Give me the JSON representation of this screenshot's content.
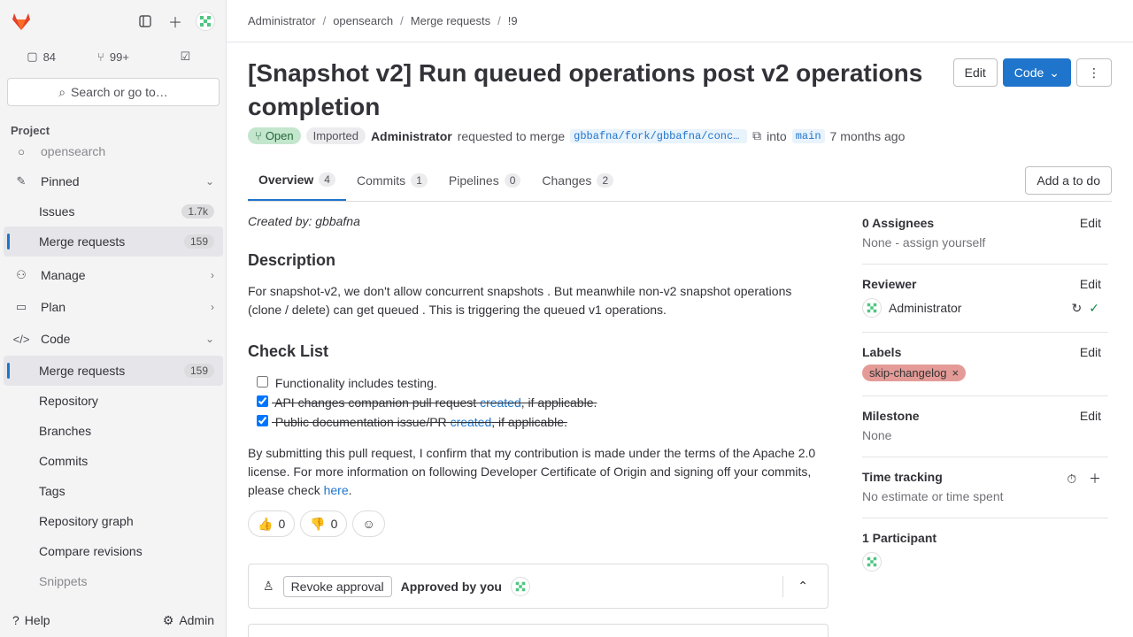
{
  "sidebar": {
    "counters": {
      "issues": "84",
      "merge_requests": "99+"
    },
    "search_label": "Search or go to…",
    "project_label": "Project",
    "items": [
      {
        "label": "opensearch"
      },
      {
        "label": "Pinned"
      },
      {
        "label": "Issues",
        "badge": "1.7k"
      },
      {
        "label": "Merge requests",
        "badge": "159"
      },
      {
        "label": "Manage"
      },
      {
        "label": "Plan"
      },
      {
        "label": "Code"
      },
      {
        "label": "Merge requests",
        "badge": "159"
      },
      {
        "label": "Repository"
      },
      {
        "label": "Branches"
      },
      {
        "label": "Commits"
      },
      {
        "label": "Tags"
      },
      {
        "label": "Repository graph"
      },
      {
        "label": "Compare revisions"
      },
      {
        "label": "Snippets"
      }
    ],
    "help_label": "Help",
    "admin_label": "Admin"
  },
  "breadcrumb": [
    "Administrator",
    "opensearch",
    "Merge requests",
    "!9"
  ],
  "mr": {
    "title": "[Snapshot v2] Run queued operations post v2 operations completion",
    "edit_label": "Edit",
    "code_label": "Code",
    "status_open": "Open",
    "status_imported": "Imported",
    "author": "Administrator",
    "requested_text": "requested to merge",
    "source_branch": "gbbafna/fork/gbbafna/concurr…",
    "into_text": "into",
    "target_branch": "main",
    "time_ago": "7 months ago"
  },
  "tabs": [
    {
      "label": "Overview",
      "count": "4"
    },
    {
      "label": "Commits",
      "count": "1"
    },
    {
      "label": "Pipelines",
      "count": "0"
    },
    {
      "label": "Changes",
      "count": "2"
    }
  ],
  "todo_label": "Add a to do",
  "description": {
    "created_by": "Created by: gbbafna",
    "heading": "Description",
    "text": "For snapshot-v2, we don't allow concurrent snapshots . But meanwhile non-v2 snapshot operations (clone / delete) can get queued . This is triggering the queued v1 operations.",
    "checklist_heading": "Check List",
    "check_1": "Functionality includes testing.",
    "check_2_pre": "API changes companion pull request ",
    "check_2_link": "created",
    "check_2_post": ", if applicable.",
    "check_3_pre": "Public documentation issue/PR ",
    "check_3_link": "created",
    "check_3_post": ", if applicable.",
    "license_pre": "By submitting this pull request, I confirm that my contribution is made under the terms of the Apache 2.0 license. For more information on following Developer Certificate of Origin and signing off your commits, please check ",
    "license_link": "here",
    "license_post": "."
  },
  "reactions": {
    "thumbs_up": "0",
    "thumbs_down": "0"
  },
  "approval": {
    "revoke_label": "Revoke approval",
    "approved_text": "Approved by you"
  },
  "right_sidebar": {
    "assignees_title": "0 Assignees",
    "assignees_value": "None - assign yourself",
    "reviewer_title": "Reviewer",
    "reviewer_name": "Administrator",
    "labels_title": "Labels",
    "label_name": "skip-changelog",
    "milestone_title": "Milestone",
    "milestone_value": "None",
    "time_title": "Time tracking",
    "time_value": "No estimate or time spent",
    "participants_title": "1 Participant",
    "edit_label": "Edit"
  },
  "colors": {
    "accent": "#1f75cb",
    "open": "#c3e6cd",
    "label": "#e49b97"
  }
}
